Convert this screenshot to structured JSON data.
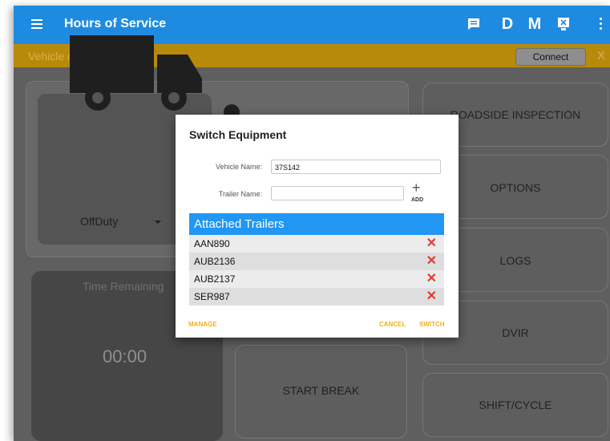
{
  "toolbar": {
    "title": "Hours of Service",
    "d_label": "D",
    "m_label": "M",
    "icons": [
      "menu-icon",
      "message-icon",
      "document-icon",
      "more-vert-icon"
    ]
  },
  "status_bar": {
    "message": "Vehicle disconnected",
    "connect_label": "Connect",
    "close_label": "X"
  },
  "duty": {
    "status": "OffDuty"
  },
  "time": {
    "label": "Time Remaining",
    "value": "00:00"
  },
  "start_break_label": "START BREAK",
  "side_buttons": {
    "roadside": "ROADSIDE INSPECTION",
    "options": "OPTIONS",
    "logs": "LOGS",
    "dvir": "DVIR",
    "shift": "SHIFT/CYCLE"
  },
  "dialog": {
    "title": "Switch Equipment",
    "vehicle_label": "Vehicle Name:",
    "vehicle_value": "37S142",
    "trailer_label": "Trailer Name:",
    "trailer_value": "",
    "add_label": "ADD",
    "attached_header": "Attached Trailers",
    "trailers": [
      "AAN890",
      "AUB2136",
      "AUB2137",
      "SER987"
    ],
    "remove_label": "✕",
    "manage_label": "MANAGE",
    "cancel_label": "CANCEL",
    "switch_label": "SWITCH"
  },
  "colors": {
    "primary": "#1e8be0",
    "warning_bar": "#b88a0a",
    "list_header": "#2196f3",
    "remove": "#e53935",
    "action": "#f2b21a"
  }
}
